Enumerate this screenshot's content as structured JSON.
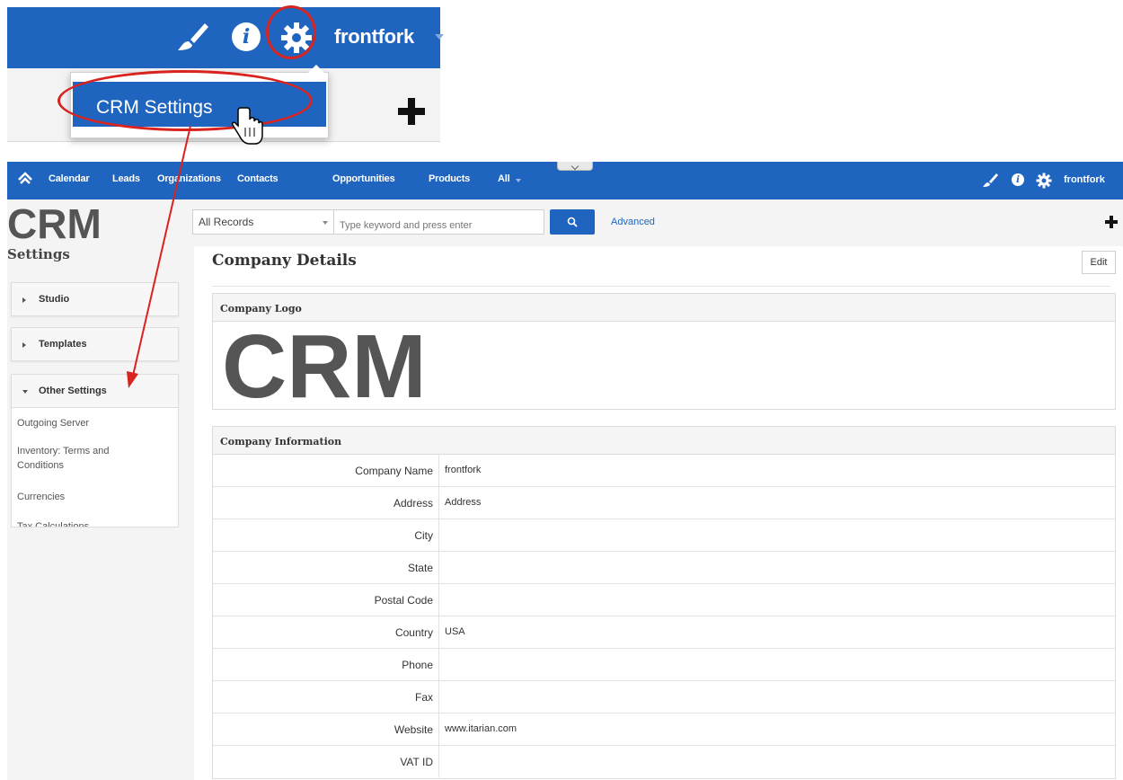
{
  "zoom_inset": {
    "username": "frontfork",
    "dropdown_item": "CRM Settings"
  },
  "nav": {
    "links": [
      "Calendar",
      "Leads",
      "Organizations",
      "Contacts",
      "Opportunities",
      "Products",
      "All"
    ],
    "username": "frontfork"
  },
  "search": {
    "records_selected": "All Records",
    "placeholder": "Type keyword and press enter",
    "advanced_label": "Advanced"
  },
  "brand": {
    "logo_text": "CRM"
  },
  "sidebar": {
    "title": "Settings",
    "panels": [
      {
        "label": "Studio",
        "expanded": false
      },
      {
        "label": "Templates",
        "expanded": false
      },
      {
        "label": "Other Settings",
        "expanded": true
      }
    ],
    "other_settings_links": [
      "Outgoing Server",
      "Inventory: Terms and Conditions",
      "Currencies",
      "Tax Calculations"
    ]
  },
  "main": {
    "title": "Company Details",
    "edit_label": "Edit",
    "logo_section_title": "Company Logo",
    "info_section_title": "Company Information",
    "fields": [
      {
        "label": "Company Name",
        "value": "frontfork"
      },
      {
        "label": "Address",
        "value": "Address"
      },
      {
        "label": "City",
        "value": ""
      },
      {
        "label": "State",
        "value": ""
      },
      {
        "label": "Postal Code",
        "value": ""
      },
      {
        "label": "Country",
        "value": "USA"
      },
      {
        "label": "Phone",
        "value": ""
      },
      {
        "label": "Fax",
        "value": ""
      },
      {
        "label": "Website",
        "value": "www.itarian.com"
      },
      {
        "label": "VAT ID",
        "value": ""
      }
    ]
  },
  "colors": {
    "brand_blue": "#1f65c0",
    "annotation_red": "#d9231f",
    "logo_gray": "#555555"
  },
  "icons": [
    "brush-icon",
    "info-icon",
    "gear-icon",
    "home-icon",
    "search-icon",
    "plus-icon",
    "hand-cursor-icon"
  ]
}
